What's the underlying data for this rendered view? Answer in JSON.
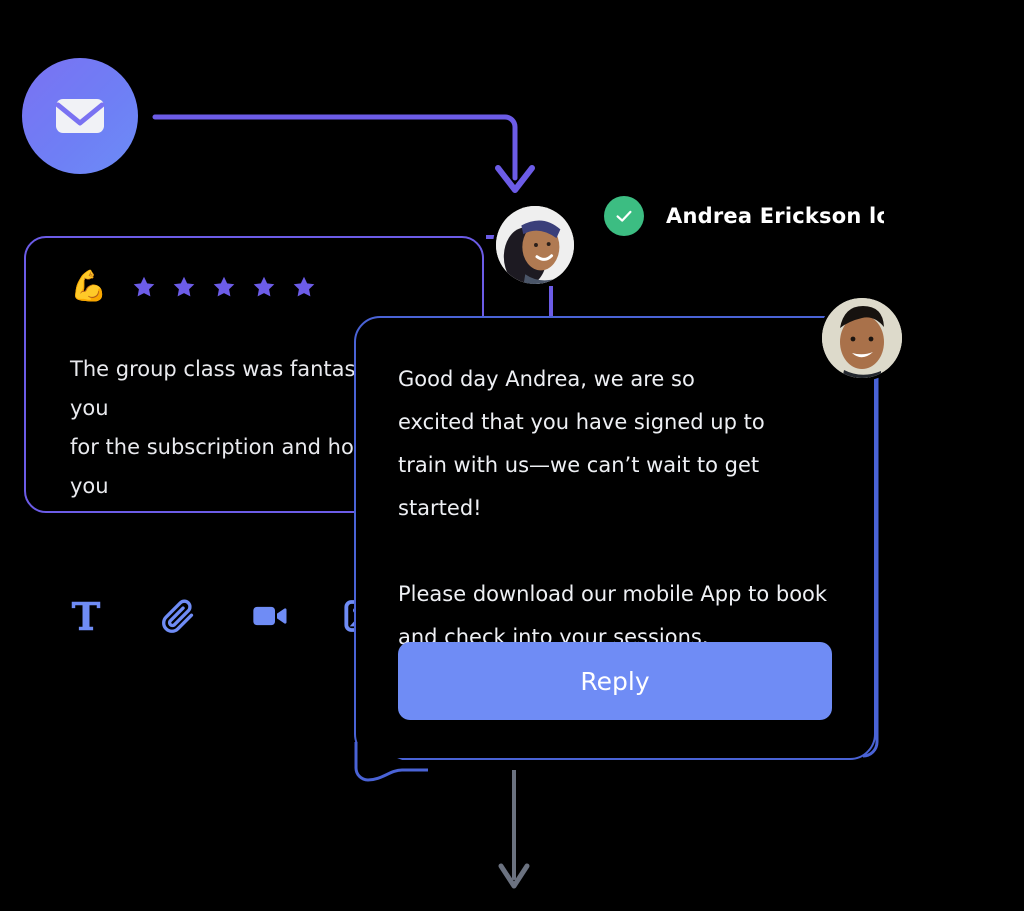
{
  "theme": {
    "background": "#000000",
    "accent_purple": "#6c5ce7",
    "accent_blue": "#4a63d6",
    "button_blue": "#6f8cf5",
    "success_green": "#3cbd82",
    "text_primary": "#eef0f4"
  },
  "mail_badge": {
    "icon": "envelope-icon",
    "gradient_from": "#7a72f2",
    "gradient_to": "#6c8cf6"
  },
  "status": {
    "icon": "check-circle-icon",
    "text": "Andrea Erickson logged in",
    "badge_color": "#3cbd82"
  },
  "review_card": {
    "reaction_emoji": "💪",
    "rating": 5,
    "max_rating": 5,
    "star_color": "#6c5ce7",
    "body": "The group class was fantastic! Thank you\nfor the subscription and hope to see you\nagain this week!"
  },
  "avatars": {
    "andrea": {
      "name": "andrea-avatar",
      "alt": "Andrea Erickson"
    },
    "coach": {
      "name": "coach-avatar",
      "alt": "Coach"
    }
  },
  "chat_bubble": {
    "paragraph_1": "Good day Andrea, we are so\nexcited that you have signed up to\ntrain with us—we can’t wait to get started!",
    "paragraph_2": "Please download our mobile App to book\nand check into your sessions.",
    "reply_label": "Reply"
  },
  "toolbar": {
    "items": [
      {
        "icon": "text-icon",
        "label": "Text"
      },
      {
        "icon": "attachment-icon",
        "label": "Attachment"
      },
      {
        "icon": "video-icon",
        "label": "Video"
      },
      {
        "icon": "image-icon",
        "label": "Image"
      }
    ],
    "icon_color": "#6f8cf5"
  },
  "connectors": {
    "mail_to_avatar_color": "#6c5ce7",
    "bubble_to_next_color": "#6b7280"
  }
}
